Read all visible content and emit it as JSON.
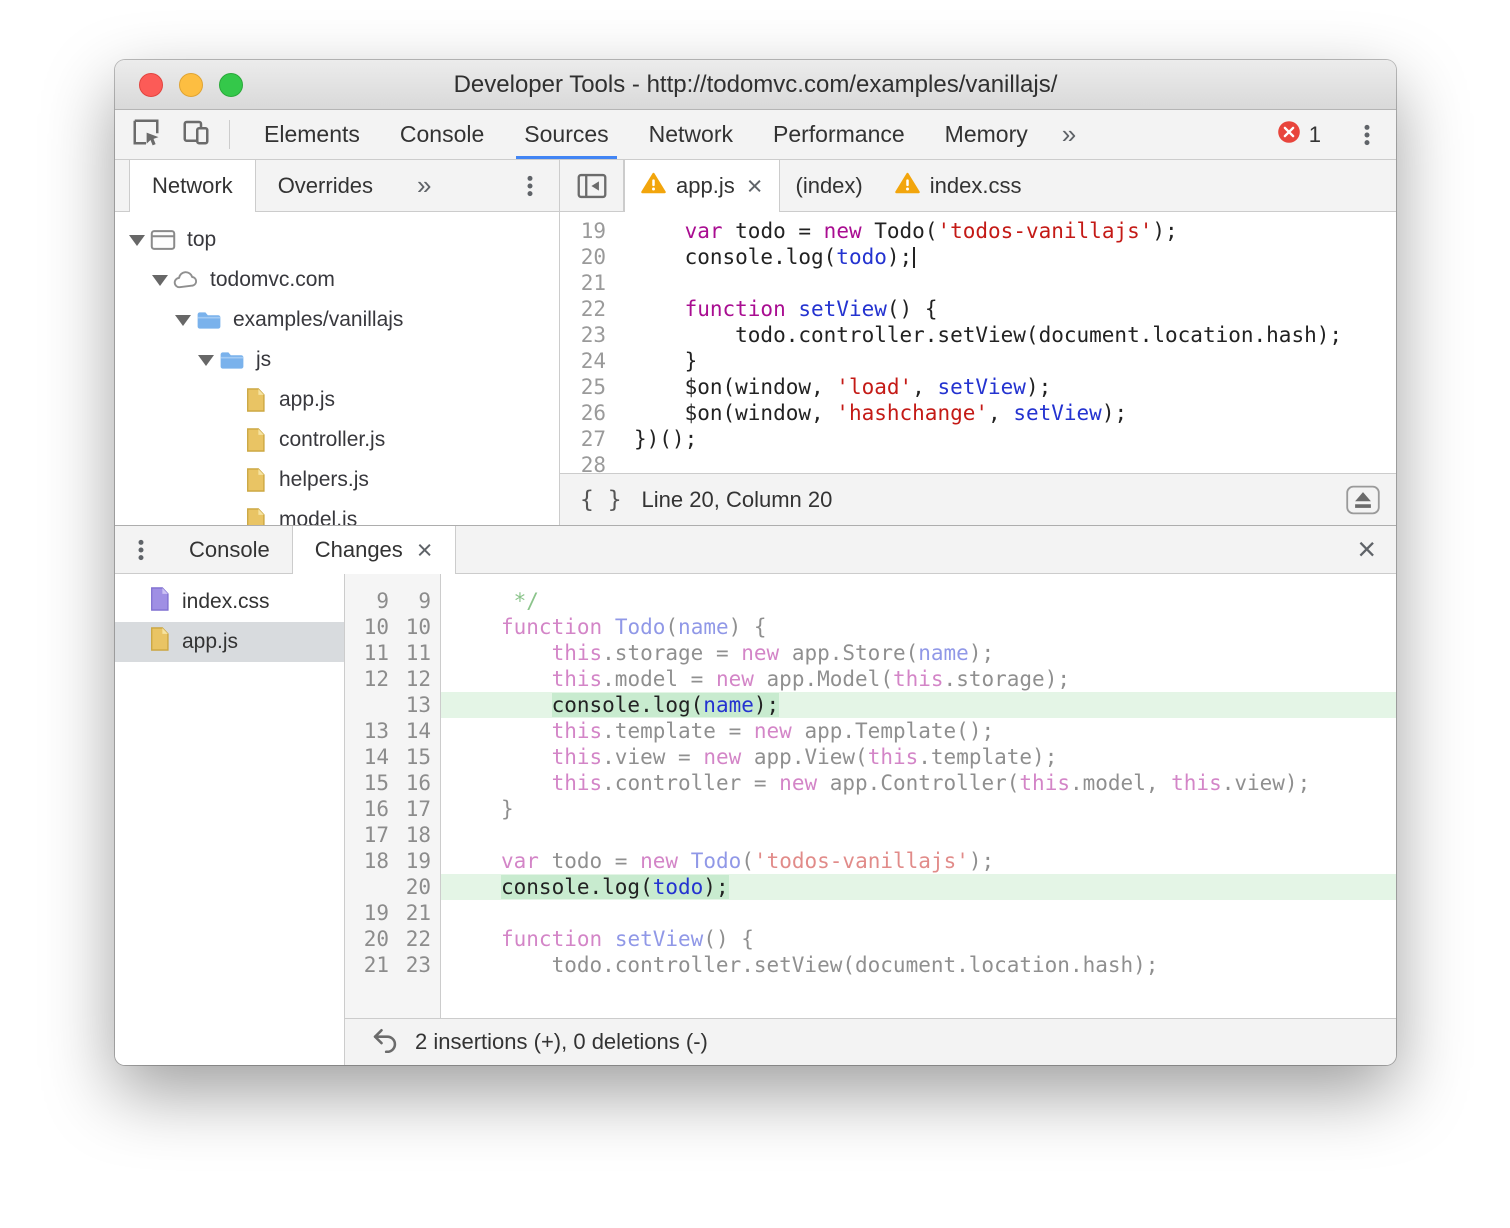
{
  "window": {
    "title": "Developer Tools - http://todomvc.com/examples/vanillajs/"
  },
  "main_toolbar": {
    "tabs": [
      "Elements",
      "Console",
      "Sources",
      "Network",
      "Performance",
      "Memory"
    ],
    "active_tab": "Sources",
    "overflow_label": "»",
    "error_count": "1"
  },
  "sidebar": {
    "tabs": [
      "Network",
      "Overrides"
    ],
    "active_tab": "Network",
    "overflow_label": "»",
    "tree": [
      {
        "label": "top",
        "level": 0,
        "icon": "frame",
        "expanded": true
      },
      {
        "label": "todomvc.com",
        "level": 1,
        "icon": "cloud",
        "expanded": true
      },
      {
        "label": "examples/vanillajs",
        "level": 2,
        "icon": "folder",
        "expanded": true
      },
      {
        "label": "js",
        "level": 3,
        "icon": "folder",
        "expanded": true
      },
      {
        "label": "app.js",
        "level": 4,
        "icon": "file-js"
      },
      {
        "label": "controller.js",
        "level": 4,
        "icon": "file-js"
      },
      {
        "label": "helpers.js",
        "level": 4,
        "icon": "file-js"
      },
      {
        "label": "model.js",
        "level": 4,
        "icon": "file-js"
      }
    ]
  },
  "sources": {
    "tabs": [
      {
        "label": "app.js",
        "warning": true,
        "closable": true,
        "active": true
      },
      {
        "label": "(index)",
        "warning": false,
        "closable": false,
        "active": false
      },
      {
        "label": "index.css",
        "warning": true,
        "closable": false,
        "active": false
      }
    ],
    "code": {
      "first_line": 19,
      "lines": [
        {
          "tokens": [
            [
              "p",
              "    "
            ],
            [
              "k",
              "var"
            ],
            [
              "p",
              " todo = "
            ],
            [
              "k",
              "new"
            ],
            [
              "p",
              " Todo("
            ],
            [
              "s",
              "'todos-vanillajs'"
            ],
            [
              "p",
              ");"
            ]
          ]
        },
        {
          "tokens": [
            [
              "p",
              "    console.log("
            ],
            [
              "d",
              "todo"
            ],
            [
              "p",
              ");"
            ]
          ],
          "caret": true
        },
        {
          "tokens": []
        },
        {
          "tokens": [
            [
              "p",
              "    "
            ],
            [
              "k",
              "function"
            ],
            [
              "p",
              " "
            ],
            [
              "d",
              "setView"
            ],
            [
              "p",
              "() {"
            ]
          ]
        },
        {
          "tokens": [
            [
              "p",
              "        todo.controller.setView(document.location.hash);"
            ]
          ]
        },
        {
          "tokens": [
            [
              "p",
              "    }"
            ]
          ]
        },
        {
          "tokens": [
            [
              "p",
              "    $on(window, "
            ],
            [
              "s",
              "'load'"
            ],
            [
              "p",
              ", "
            ],
            [
              "d",
              "setView"
            ],
            [
              "p",
              ");"
            ]
          ]
        },
        {
          "tokens": [
            [
              "p",
              "    $on(window, "
            ],
            [
              "s",
              "'hashchange'"
            ],
            [
              "p",
              ", "
            ],
            [
              "d",
              "setView"
            ],
            [
              "p",
              ");"
            ]
          ]
        },
        {
          "tokens": [
            [
              "p",
              "})();"
            ]
          ]
        },
        {
          "tokens": []
        }
      ]
    },
    "status": {
      "line_col": "Line 20, Column 20"
    }
  },
  "drawer": {
    "tabs": [
      "Console",
      "Changes"
    ],
    "active_tab": "Changes",
    "files": [
      {
        "label": "index.css",
        "icon": "file-css",
        "selected": false
      },
      {
        "label": "app.js",
        "icon": "file-js",
        "selected": true
      }
    ],
    "diff": {
      "rows": [
        {
          "old": "9",
          "new": "9",
          "type": "same",
          "tokens": [
            [
              "c",
              " */"
            ]
          ]
        },
        {
          "old": "10",
          "new": "10",
          "type": "same",
          "tokens": [
            [
              "k",
              "function"
            ],
            [
              "p",
              " "
            ],
            [
              "d",
              "Todo"
            ],
            [
              "p",
              "("
            ],
            [
              "d",
              "name"
            ],
            [
              "p",
              ") {"
            ]
          ]
        },
        {
          "old": "11",
          "new": "11",
          "type": "same",
          "tokens": [
            [
              "p",
              "    "
            ],
            [
              "k",
              "this"
            ],
            [
              "p",
              ".storage = "
            ],
            [
              "k",
              "new"
            ],
            [
              "p",
              " app.Store("
            ],
            [
              "d",
              "name"
            ],
            [
              "p",
              ");"
            ]
          ]
        },
        {
          "old": "12",
          "new": "12",
          "type": "same",
          "tokens": [
            [
              "p",
              "    "
            ],
            [
              "k",
              "this"
            ],
            [
              "p",
              ".model = "
            ],
            [
              "k",
              "new"
            ],
            [
              "p",
              " app.Model("
            ],
            [
              "k",
              "this"
            ],
            [
              "p",
              ".storage);"
            ]
          ]
        },
        {
          "old": "",
          "new": "13",
          "type": "insert",
          "tokens": [
            [
              "p",
              "    "
            ],
            [
              "p",
              "console.log("
            ],
            [
              "d",
              "name"
            ],
            [
              "p",
              ");"
            ]
          ]
        },
        {
          "old": "13",
          "new": "14",
          "type": "same",
          "tokens": [
            [
              "p",
              "    "
            ],
            [
              "k",
              "this"
            ],
            [
              "p",
              ".template = "
            ],
            [
              "k",
              "new"
            ],
            [
              "p",
              " app.Template();"
            ]
          ]
        },
        {
          "old": "14",
          "new": "15",
          "type": "same",
          "tokens": [
            [
              "p",
              "    "
            ],
            [
              "k",
              "this"
            ],
            [
              "p",
              ".view = "
            ],
            [
              "k",
              "new"
            ],
            [
              "p",
              " app.View("
            ],
            [
              "k",
              "this"
            ],
            [
              "p",
              ".template);"
            ]
          ]
        },
        {
          "old": "15",
          "new": "16",
          "type": "same",
          "tokens": [
            [
              "p",
              "    "
            ],
            [
              "k",
              "this"
            ],
            [
              "p",
              ".controller = "
            ],
            [
              "k",
              "new"
            ],
            [
              "p",
              " app.Controller("
            ],
            [
              "k",
              "this"
            ],
            [
              "p",
              ".model, "
            ],
            [
              "k",
              "this"
            ],
            [
              "p",
              ".view);"
            ]
          ]
        },
        {
          "old": "16",
          "new": "17",
          "type": "same",
          "tokens": [
            [
              "p",
              "}"
            ]
          ]
        },
        {
          "old": "17",
          "new": "18",
          "type": "same",
          "tokens": []
        },
        {
          "old": "18",
          "new": "19",
          "type": "same",
          "tokens": [
            [
              "k",
              "var"
            ],
            [
              "p",
              " todo = "
            ],
            [
              "k",
              "new"
            ],
            [
              "p",
              " "
            ],
            [
              "d",
              "Todo"
            ],
            [
              "p",
              "("
            ],
            [
              "s",
              "'todos-vanillajs'"
            ],
            [
              "p",
              ");"
            ]
          ]
        },
        {
          "old": "",
          "new": "20",
          "type": "insert",
          "tokens": [
            [
              "p",
              "console.log("
            ],
            [
              "d",
              "todo"
            ],
            [
              "p",
              ");"
            ]
          ]
        },
        {
          "old": "19",
          "new": "21",
          "type": "same",
          "tokens": []
        },
        {
          "old": "20",
          "new": "22",
          "type": "same",
          "tokens": [
            [
              "k",
              "function"
            ],
            [
              "p",
              " "
            ],
            [
              "d",
              "setView"
            ],
            [
              "p",
              "() {"
            ]
          ]
        },
        {
          "old": "21",
          "new": "23",
          "type": "same",
          "tokens": [
            [
              "p",
              "    todo.controller.setView(document.location.hash);"
            ]
          ]
        }
      ]
    },
    "summary": "2 insertions (+), 0 deletions (-)"
  },
  "colors": {
    "accent_blue": "#4285f4",
    "error_red": "#e8453c",
    "warning_yellow": "#f2a50c",
    "insert_row_bg": "#e4f5e6",
    "insert_text_bg": "#c8ebcf",
    "keyword": "#a90d91",
    "string": "#c41a16",
    "identifier_blue": "#2433d0",
    "comment_green": "#1a8a1a"
  }
}
